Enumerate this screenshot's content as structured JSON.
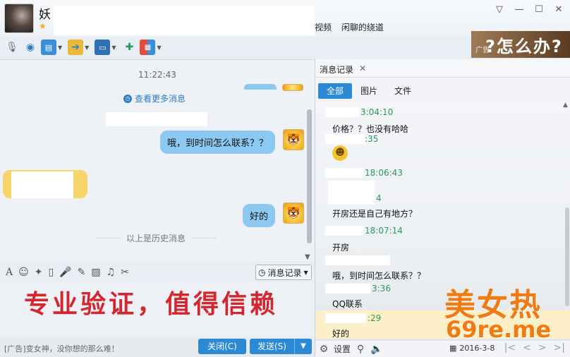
{
  "header": {
    "contact_name": "妖",
    "nav_links": [
      "视频",
      "闲聊的绕道"
    ]
  },
  "top_ad": {
    "text": "?怎么办?",
    "tag": "广告"
  },
  "chat": {
    "timestamp": "11:22:43",
    "more_messages": "查看更多消息",
    "messages": [
      {
        "text": "哦，到时间怎么联系？？"
      },
      {
        "text": "好的"
      }
    ],
    "history_divider": "以上是历史消息"
  },
  "input_toolbar": {
    "message_record": "消息记录"
  },
  "input_watermark": "专业验证，值得信赖",
  "bottom_bar": {
    "ad_text": "[广告]变女神，没你想的那么难！",
    "close_label": "关闭(C)",
    "send_label": "发送(S)"
  },
  "record_panel": {
    "tab_label": "消息记录",
    "subtabs": [
      "全部",
      "图片",
      "文件"
    ],
    "entries": [
      {
        "time": "3:04:10",
        "msg": "价格？？也没有哈哈"
      },
      {
        "time": ":35",
        "msg": ""
      },
      {
        "time": "18:06:43",
        "msg": ""
      },
      {
        "time": "4",
        "msg": "开房还是自己有地方？"
      },
      {
        "time": "18:07:14",
        "msg": "开房"
      },
      {
        "time": "",
        "msg": "哦，到时间怎么联系？？"
      },
      {
        "time": "3:36",
        "msg": "QQ联系"
      },
      {
        "time": ":29",
        "msg": "好的"
      }
    ],
    "settings_label": "设置",
    "date": "2016-3-8"
  },
  "watermark": {
    "hot": "美女热",
    "url": "69re.me"
  },
  "colors": {
    "accent": "#2c8ad5",
    "bubble": "#8cc9f2",
    "time_green": "#2a9a5a",
    "watermark_red": "#d3262f",
    "watermark_orange": "#f07b12"
  }
}
